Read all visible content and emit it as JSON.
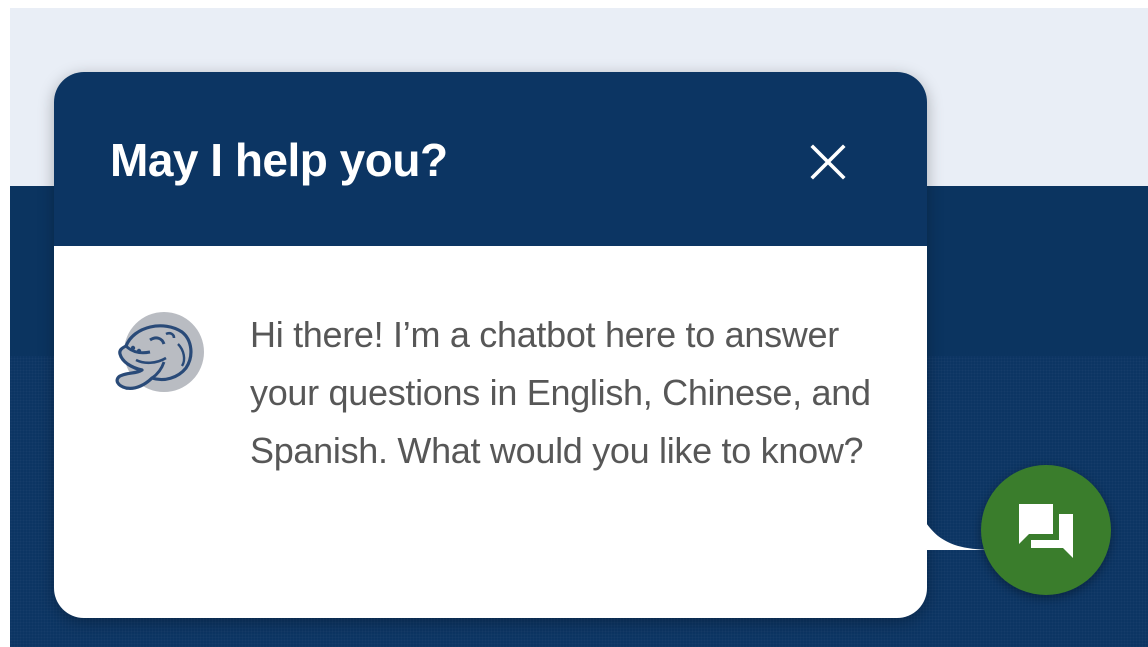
{
  "chat_popup": {
    "title": "May I help you?",
    "close_icon": "close-icon",
    "avatar_icon": "manatee-mascot-icon",
    "message": "Hi there! I’m a chatbot here to answer your questions in English, Chinese, and Spanish. What would you like to know?"
  },
  "launcher": {
    "icon": "chat-bubbles-icon"
  },
  "colors": {
    "header_bg": "#0c3563",
    "page_band_bg": "#0b3460",
    "page_top_bg": "#e9eef6",
    "launcher_bg": "#3a7d2c",
    "message_text": "#575757",
    "avatar_fill": "#b9bcc2",
    "avatar_stroke": "#294a78"
  }
}
